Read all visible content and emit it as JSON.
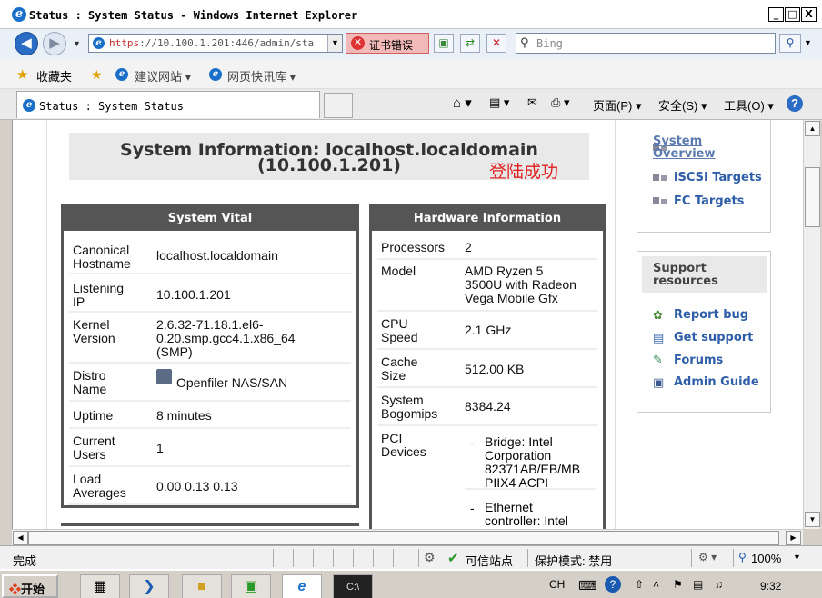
{
  "window": {
    "title": "Status : System Status - Windows Internet Explorer",
    "min": "_",
    "max": "□",
    "close": "X"
  },
  "toolbar": {
    "address_scheme": "https",
    "address_rest": "://10.100.1.201:446/admin/sta",
    "cert_error": "证书错误",
    "search_placeholder": "Bing"
  },
  "favorites": {
    "label": "收藏夹",
    "items": [
      "建议网站 ▾",
      "网页快讯库 ▾"
    ]
  },
  "tabs": [
    {
      "label": "Status : System Status"
    }
  ],
  "command_bar": {
    "page": "页面(P) ▾",
    "safety": "安全(S) ▾",
    "tools": "工具(O) ▾",
    "help": "?"
  },
  "page": {
    "header": {
      "line1": "System Information: localhost.localdomain",
      "line2": "(10.100.1.201)",
      "login_note": "登陆成功"
    },
    "vital": {
      "title": "System Vital",
      "rows": [
        {
          "k": "Canonical\nHostname",
          "v": "localhost.localdomain"
        },
        {
          "k": "Listening\nIP",
          "v": "10.100.1.201"
        },
        {
          "k": "Kernel\nVersion",
          "v": "2.6.32-71.18.1.el6-\n0.20.smp.gcc4.1.x86_64\n(SMP)"
        },
        {
          "k": "Distro\nName",
          "v": "Openfiler NAS/SAN"
        },
        {
          "k": "Uptime",
          "v": "8 minutes"
        },
        {
          "k": "Current\nUsers",
          "v": "1"
        },
        {
          "k": "Load\nAverages",
          "v": "0.00 0.13 0.13"
        }
      ]
    },
    "hardware": {
      "title": "Hardware Information",
      "rows": [
        {
          "k": "Processors",
          "v": "2"
        },
        {
          "k": "Model",
          "v": "AMD Ryzen 5\n3500U with Radeon\nVega Mobile Gfx"
        },
        {
          "k": "CPU\nSpeed",
          "v": "2.1 GHz"
        },
        {
          "k": "Cache\nSize",
          "v": "512.00 KB"
        },
        {
          "k": "System\nBogomips",
          "v": "8384.24"
        },
        {
          "k": "PCI\nDevices",
          "v": ""
        }
      ],
      "pci": [
        "Bridge: Intel\nCorporation\n82371AB/EB/MB\nPIIX4 ACPI",
        "Ethernet\ncontroller: Intel\nCorporation"
      ]
    },
    "nav": {
      "overview": "System\nOverview",
      "iscsi": "iSCSI Targets",
      "fc": "FC Targets"
    },
    "support": {
      "title": "Support\nresources",
      "links": [
        "Report bug",
        "Get support",
        "Forums",
        "Admin Guide"
      ]
    }
  },
  "status": {
    "left": "完成",
    "trusted": "可信站点",
    "protected": "保护模式: 禁用",
    "zoom": "100%"
  },
  "taskbar": {
    "start": "开始",
    "lang": "CH",
    "time": "9:32"
  }
}
